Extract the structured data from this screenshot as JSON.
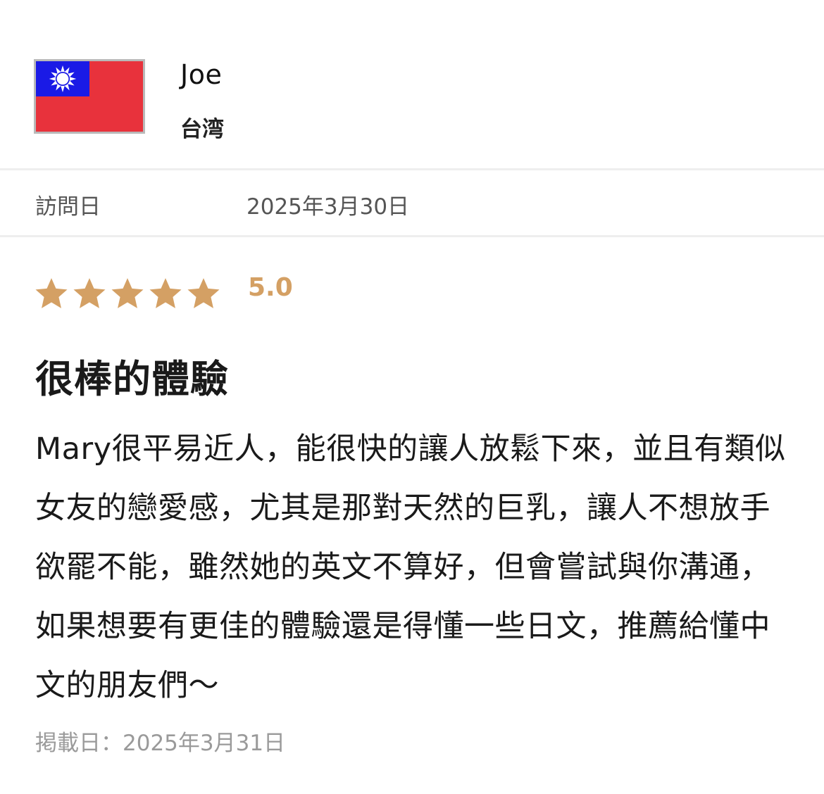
{
  "reviewer": {
    "name": "Joe",
    "country": "台湾",
    "flag_icon": "taiwan-flag-icon",
    "flag_colors": {
      "red": "#E8323C",
      "blue": "#1A1AE6",
      "sun": "#FFFFFF"
    }
  },
  "visit": {
    "label": "訪問日",
    "date": "2025年3月30日"
  },
  "rating": {
    "stars": 5,
    "max_stars": 5,
    "score": "5.0",
    "star_color": "#D4A064"
  },
  "review": {
    "title": "很棒的體驗",
    "body": "Mary很平易近人，能很快的讓人放鬆下來，並且有類似女友的戀愛感，尤其是那對天然的巨乳，讓人不想放手欲罷不能，雖然她的英文不算好，但會嘗試與你溝通，如果想要有更佳的體驗還是得懂一些日文，推薦給懂中文的朋友們～",
    "posted": "掲載日：2025年3月31日"
  }
}
